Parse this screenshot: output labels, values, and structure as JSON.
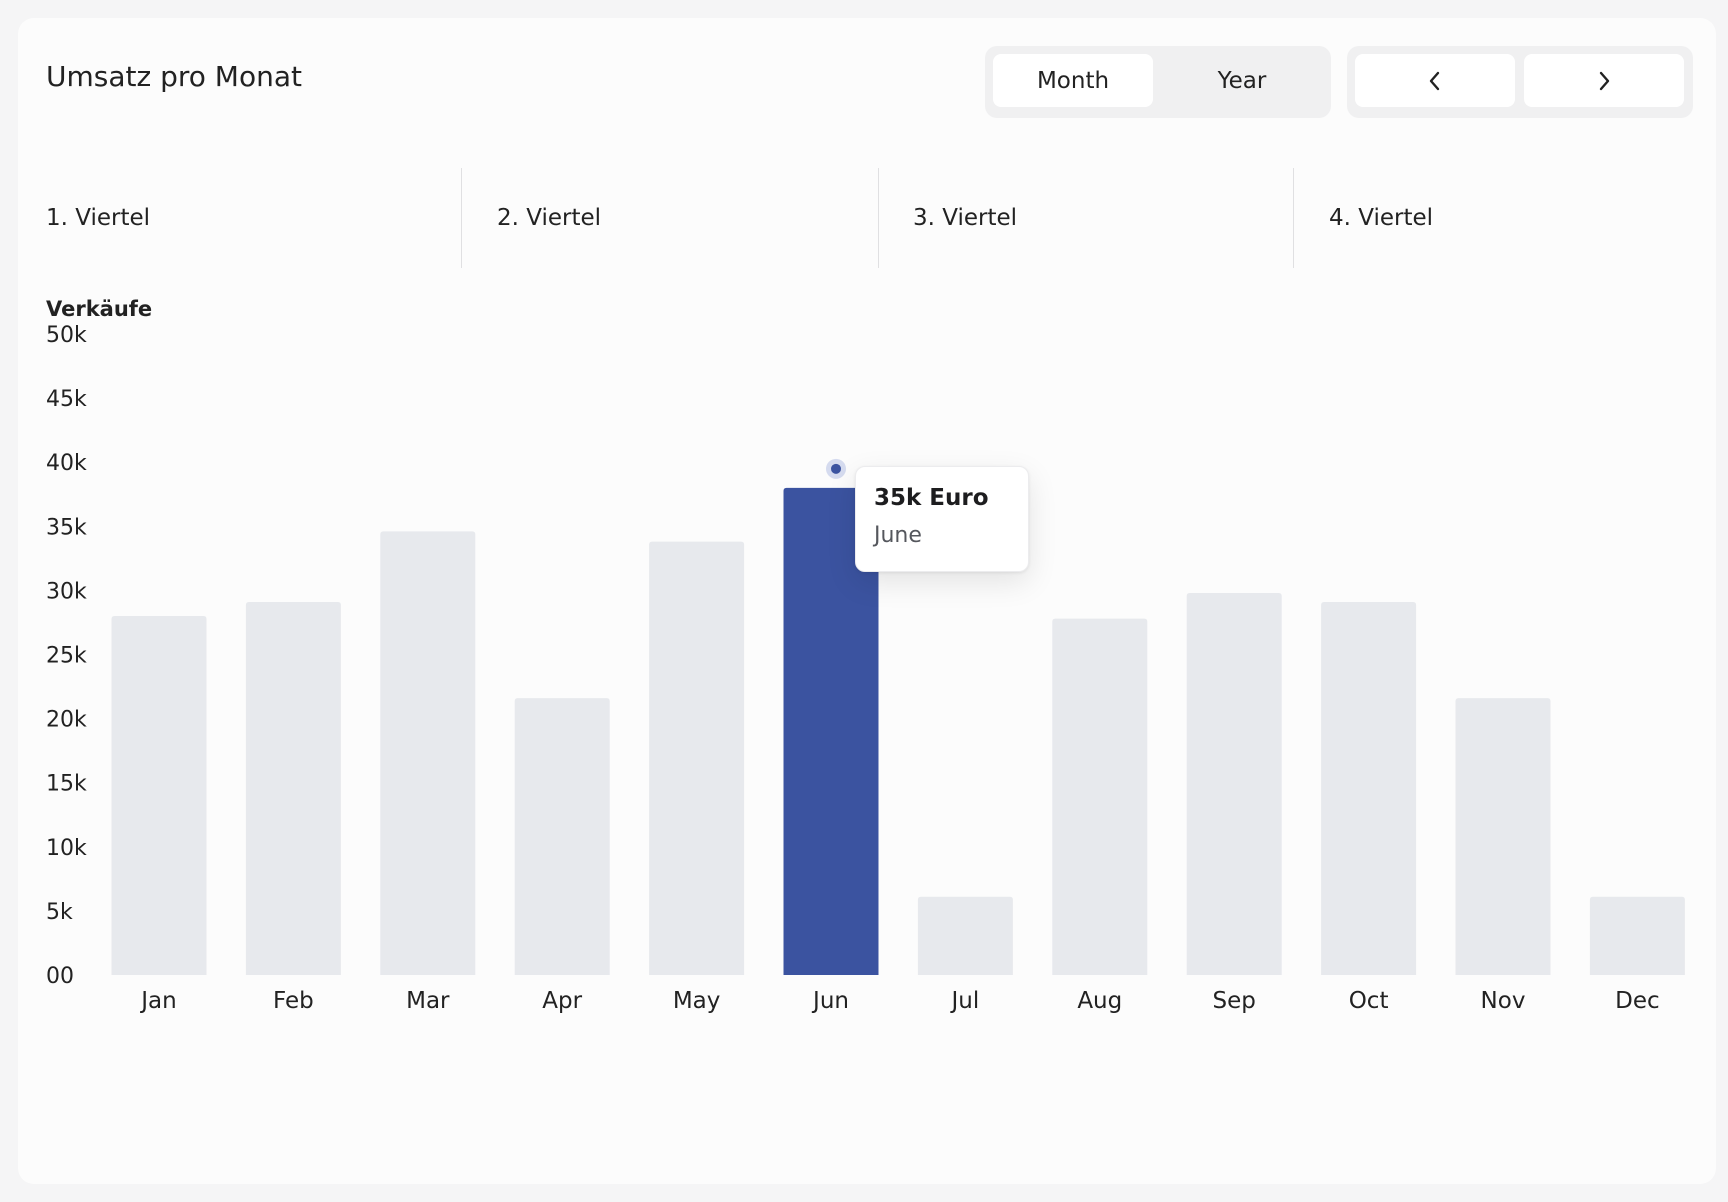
{
  "header": {
    "title": "Umsatz pro Monat"
  },
  "view_toggle": {
    "month_label": "Month",
    "year_label": "Year",
    "active": "Month"
  },
  "nav": {
    "prev_icon": "chevron-left-icon",
    "next_icon": "chevron-right-icon",
    "prev_glyph": "‹",
    "next_glyph": "›"
  },
  "quarters": [
    "1. Viertel",
    "2. Viertel",
    "3. Viertel",
    "4. Viertel"
  ],
  "tooltip": {
    "value": "35k Euro",
    "label": "June"
  },
  "chart_data": {
    "type": "bar",
    "ylabel": "Verkäufe",
    "categories": [
      "Jan",
      "Feb",
      "Mar",
      "Apr",
      "May",
      "Jun",
      "Jul",
      "Aug",
      "Sep",
      "Oct",
      "Nov",
      "Dec"
    ],
    "values": [
      28000,
      29100,
      34600,
      21600,
      33800,
      38000,
      6100,
      27800,
      29800,
      29100,
      21600,
      6100
    ],
    "ylim": [
      0,
      50000
    ],
    "yticks": [
      "00",
      "5k",
      "10k",
      "15k",
      "20k",
      "25k",
      "30k",
      "35k",
      "40k",
      "45k",
      "50k"
    ],
    "highlight_index": 5,
    "colors": {
      "bar": "#e7e9ed",
      "highlight": "#3b53a0",
      "marker_outer": "#d5dbef"
    },
    "grid": false,
    "legend": "none"
  }
}
